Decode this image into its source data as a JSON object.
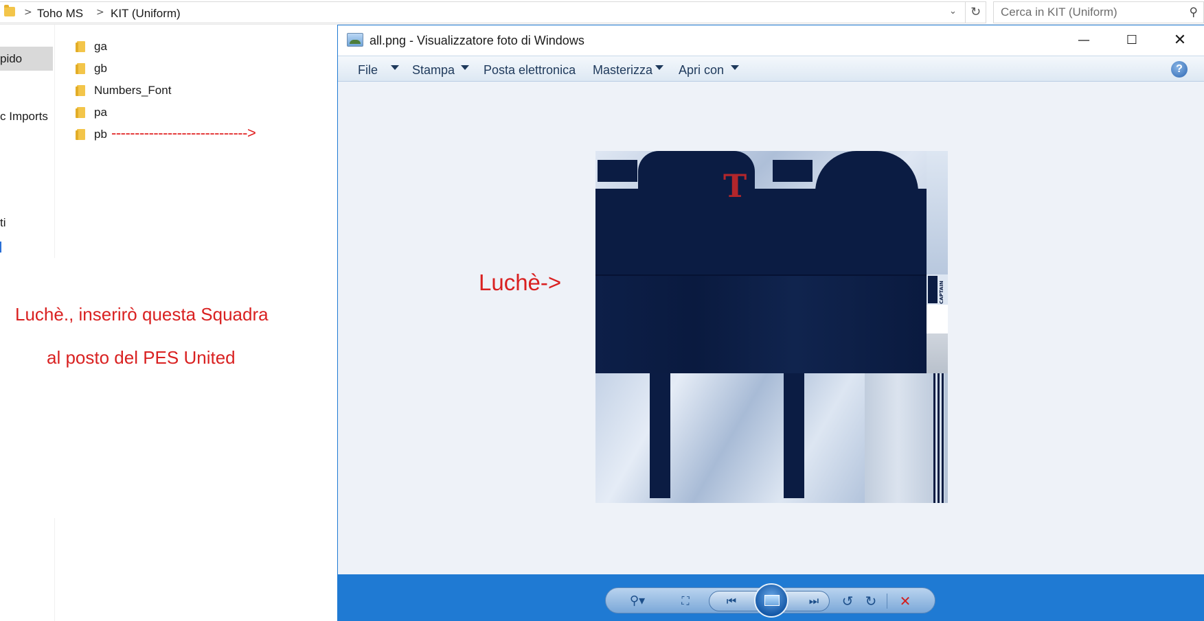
{
  "explorer": {
    "breadcrumb": [
      "Toho MS",
      "KIT (Uniform)"
    ],
    "breadcrumb_separator": ">",
    "dropdown_icon": "chevron-down-icon",
    "refresh_icon": "refresh-icon",
    "search_placeholder": "Cerca in KIT (Uniform)",
    "nav": {
      "quick_access": "pido",
      "imports": "c Imports",
      "item_ti": "ti"
    },
    "files": [
      "ga",
      "gb",
      "Numbers_Font",
      "pa",
      "pb"
    ]
  },
  "annotations": {
    "arrow": "----------------------------->",
    "note_line1": "Luchè., inserirò questa Squadra",
    "note_line2": "al posto del PES United",
    "luche_arrow": "Luchè->"
  },
  "viewer": {
    "title": "all.png - Visualizzatore foto di Windows",
    "window_controls": {
      "minimize": "—",
      "maximize": "☐",
      "close": "✕"
    },
    "menu": [
      "File",
      "Stampa",
      "Posta elettronica",
      "Masterizza",
      "Apri con"
    ],
    "help_label": "?",
    "texture": {
      "logo_letter": "T",
      "captain_label": "CAPTAIN"
    },
    "controls": {
      "zoom": "⚲▾",
      "fit": "⛶",
      "prev": "⏮",
      "next": "⏭",
      "rotate_left": "↺",
      "rotate_right": "↻",
      "delete": "✕"
    }
  },
  "colors": {
    "accent_blue": "#1f7ad3",
    "annotation_red": "#d92121",
    "kit_navy": "#0b1c43",
    "kit_logo_red": "#b3262b"
  }
}
